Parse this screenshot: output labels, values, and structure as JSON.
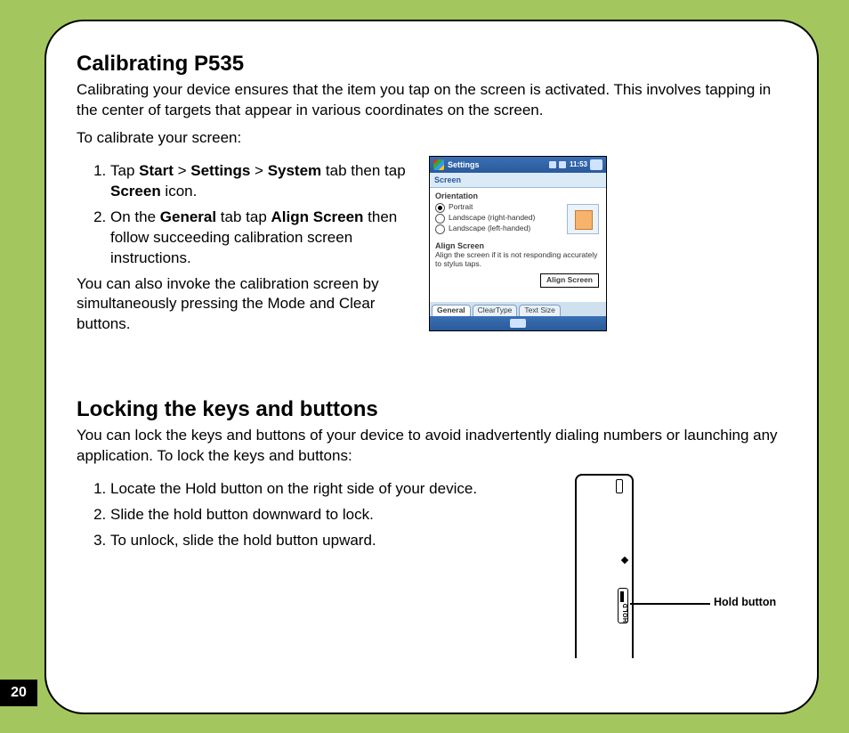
{
  "page_number": "20",
  "section1": {
    "heading": "Calibrating P535",
    "intro": "Calibrating your device ensures that the item you tap on the screen is activated. This involves tapping in the center of targets that appear in various coordinates on the screen.",
    "lead": "To calibrate your screen:",
    "steps": [
      {
        "pre": "Tap ",
        "b1": "Start",
        "mid1": " > ",
        "b2": "Settings",
        "mid2": " > ",
        "b3": "System",
        "post1": " tab then tap ",
        "b4": "Screen",
        "post2": " icon."
      },
      {
        "pre": "On the ",
        "b1": "General",
        "mid1": " tab tap ",
        "b2": "Align Screen",
        "post1": " then follow succeeding calibration screen instructions."
      }
    ],
    "after": "You can also invoke the calibration screen by simultaneously pressing the Mode and Clear buttons."
  },
  "device_shot": {
    "title": "Settings",
    "time": "11:53",
    "bread": "Screen",
    "orientation_title": "Orientation",
    "radio_portrait": "Portrait",
    "radio_land_r": "Landscape (right-handed)",
    "radio_land_l": "Landscape (left-handed)",
    "align_title": "Align Screen",
    "align_desc": "Align the screen if it is not responding accurately to stylus taps.",
    "align_btn": "Align Screen",
    "tabs": {
      "general": "General",
      "cleartype": "ClearType",
      "textsize": "Text Size"
    }
  },
  "section2": {
    "heading": "Locking the keys and buttons",
    "intro": "You can lock the keys and buttons of your device to avoid inadvertently dialing numbers or launching any application. To lock the keys and buttons:",
    "steps": [
      "Locate the Hold button on the right side of your device.",
      "Slide the hold button downward to lock.",
      "To unlock, slide the hold button upward."
    ]
  },
  "illustration": {
    "hold_vertical": "HOLD",
    "hold_label": "Hold button"
  }
}
